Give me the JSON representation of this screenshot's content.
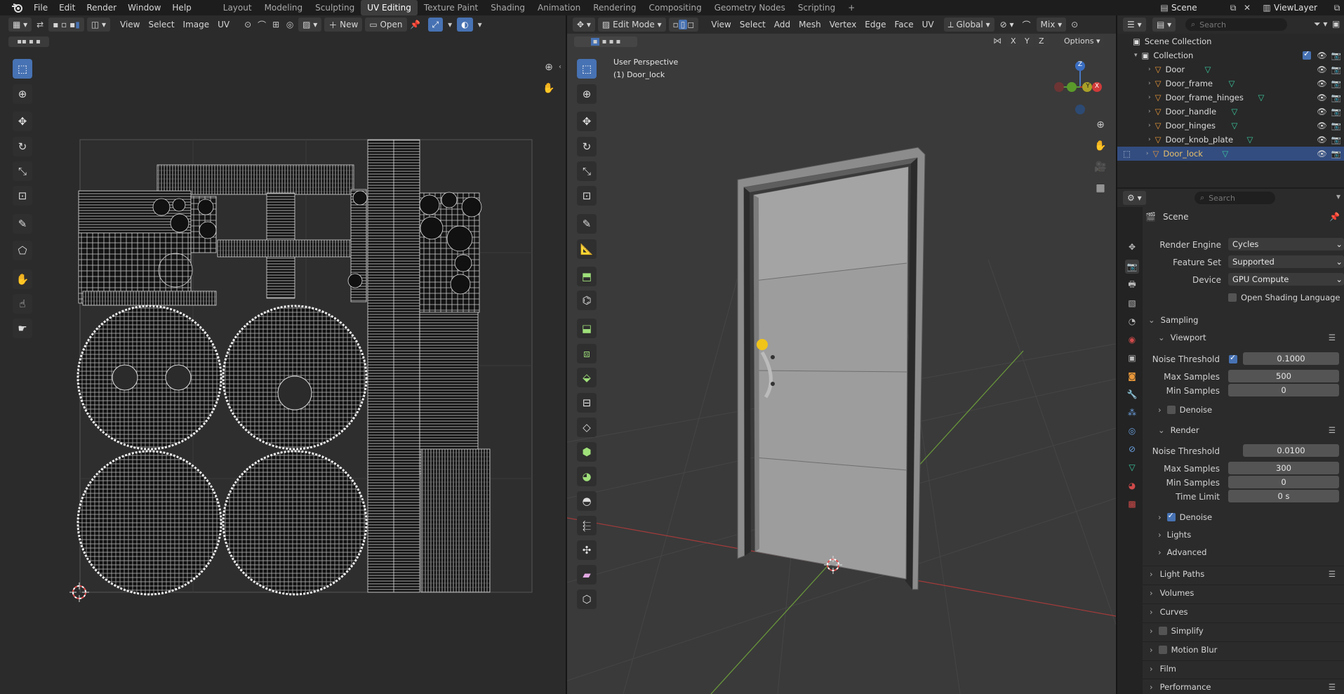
{
  "topbar": {
    "logo": "blender-logo",
    "menus": [
      "File",
      "Edit",
      "Render",
      "Window",
      "Help"
    ],
    "workspaces": [
      "Layout",
      "Modeling",
      "Sculpting",
      "UV Editing",
      "Texture Paint",
      "Shading",
      "Animation",
      "Rendering",
      "Compositing",
      "Geometry Nodes",
      "Scripting"
    ],
    "active_workspace": "UV Editing",
    "add_tab": "+",
    "scene_name": "Scene",
    "view_layer": "ViewLayer"
  },
  "uv_editor": {
    "menus": [
      "View",
      "Select",
      "Image",
      "UV"
    ],
    "new_label": "New",
    "open_label": "Open"
  },
  "viewport": {
    "mode": "Edit Mode",
    "menus": [
      "View",
      "Select",
      "Add",
      "Mesh",
      "Vertex",
      "Edge",
      "Face",
      "UV"
    ],
    "transform_orientation": "Global",
    "snap_mode": "Mix",
    "overlay_info_line1": "User Perspective",
    "overlay_info_line2": "(1) Door_lock",
    "axis_x": "X",
    "axis_y": "Y",
    "axis_z": "Z",
    "options_label": "Options",
    "gizmo_x": "X",
    "gizmo_y": "Y",
    "gizmo_z": "Z"
  },
  "outliner": {
    "search_placeholder": "Search",
    "scene_collection": "Scene Collection",
    "collection": "Collection",
    "objects": [
      "Door",
      "Door_frame",
      "Door_frame_hinges",
      "Door_handle",
      "Door_hinges",
      "Door_knob_plate",
      "Door_lock"
    ],
    "selected": "Door_lock"
  },
  "properties": {
    "search_placeholder": "Search",
    "context": "Scene",
    "render_engine_label": "Render Engine",
    "render_engine": "Cycles",
    "feature_set_label": "Feature Set",
    "feature_set": "Supported",
    "device_label": "Device",
    "device": "GPU Compute",
    "osl_label": "Open Shading Language",
    "sampling": "Sampling",
    "viewport": "Viewport",
    "noise_threshold_label": "Noise Threshold",
    "viewport_noise_threshold": "0.1000",
    "max_samples_label": "Max Samples",
    "viewport_max_samples": "500",
    "min_samples_label": "Min Samples",
    "viewport_min_samples": "0",
    "denoise_label": "Denoise",
    "render": "Render",
    "render_noise_threshold": "0.0100",
    "render_max_samples": "300",
    "render_min_samples": "0",
    "time_limit_label": "Time Limit",
    "time_limit": "0 s",
    "lights": "Lights",
    "advanced": "Advanced",
    "light_paths": "Light Paths",
    "volumes": "Volumes",
    "curves": "Curves",
    "simplify": "Simplify",
    "motion_blur": "Motion Blur",
    "film": "Film",
    "performance": "Performance"
  },
  "colors": {
    "accent": "#4772b3",
    "selected_row": "#334d80",
    "background": "#1d1d1d",
    "panel": "#2b2b2b"
  }
}
